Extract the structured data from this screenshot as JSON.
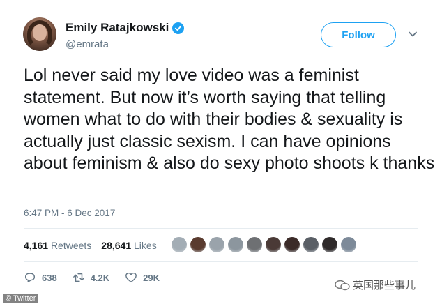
{
  "user": {
    "name": "Emily Ratajkowski",
    "handle": "@emrata"
  },
  "follow_label": "Follow",
  "tweet": {
    "text": "Lol never said my love video was a feminist statement. But now it’s worth saying that telling women what to do with their bodies & sexuality is actually  just classic sexism. I can have opinions about feminism & also do sexy photo shoots k thanks",
    "timestamp": "6:47 PM - 6 Dec 2017"
  },
  "stats": {
    "retweets_count": "4,161",
    "retweets_label": "Retweets",
    "likes_count": "28,641",
    "likes_label": "Likes"
  },
  "likers": [
    "#a3adb5",
    "#5a3b2f",
    "#9aa3ab",
    "#8c969e",
    "#6e7073",
    "#4a3a36",
    "#3b2b28",
    "#5a5f66",
    "#2f2a2a",
    "#7d8a99"
  ],
  "actions": {
    "replies": "638",
    "retweets": "4.2K",
    "likes": "29K"
  },
  "credit": "© Twitter",
  "watermark": "英国那些事儿",
  "colors": {
    "accent": "#1da1f2",
    "secondary_text": "#657786",
    "text": "#14171a"
  }
}
